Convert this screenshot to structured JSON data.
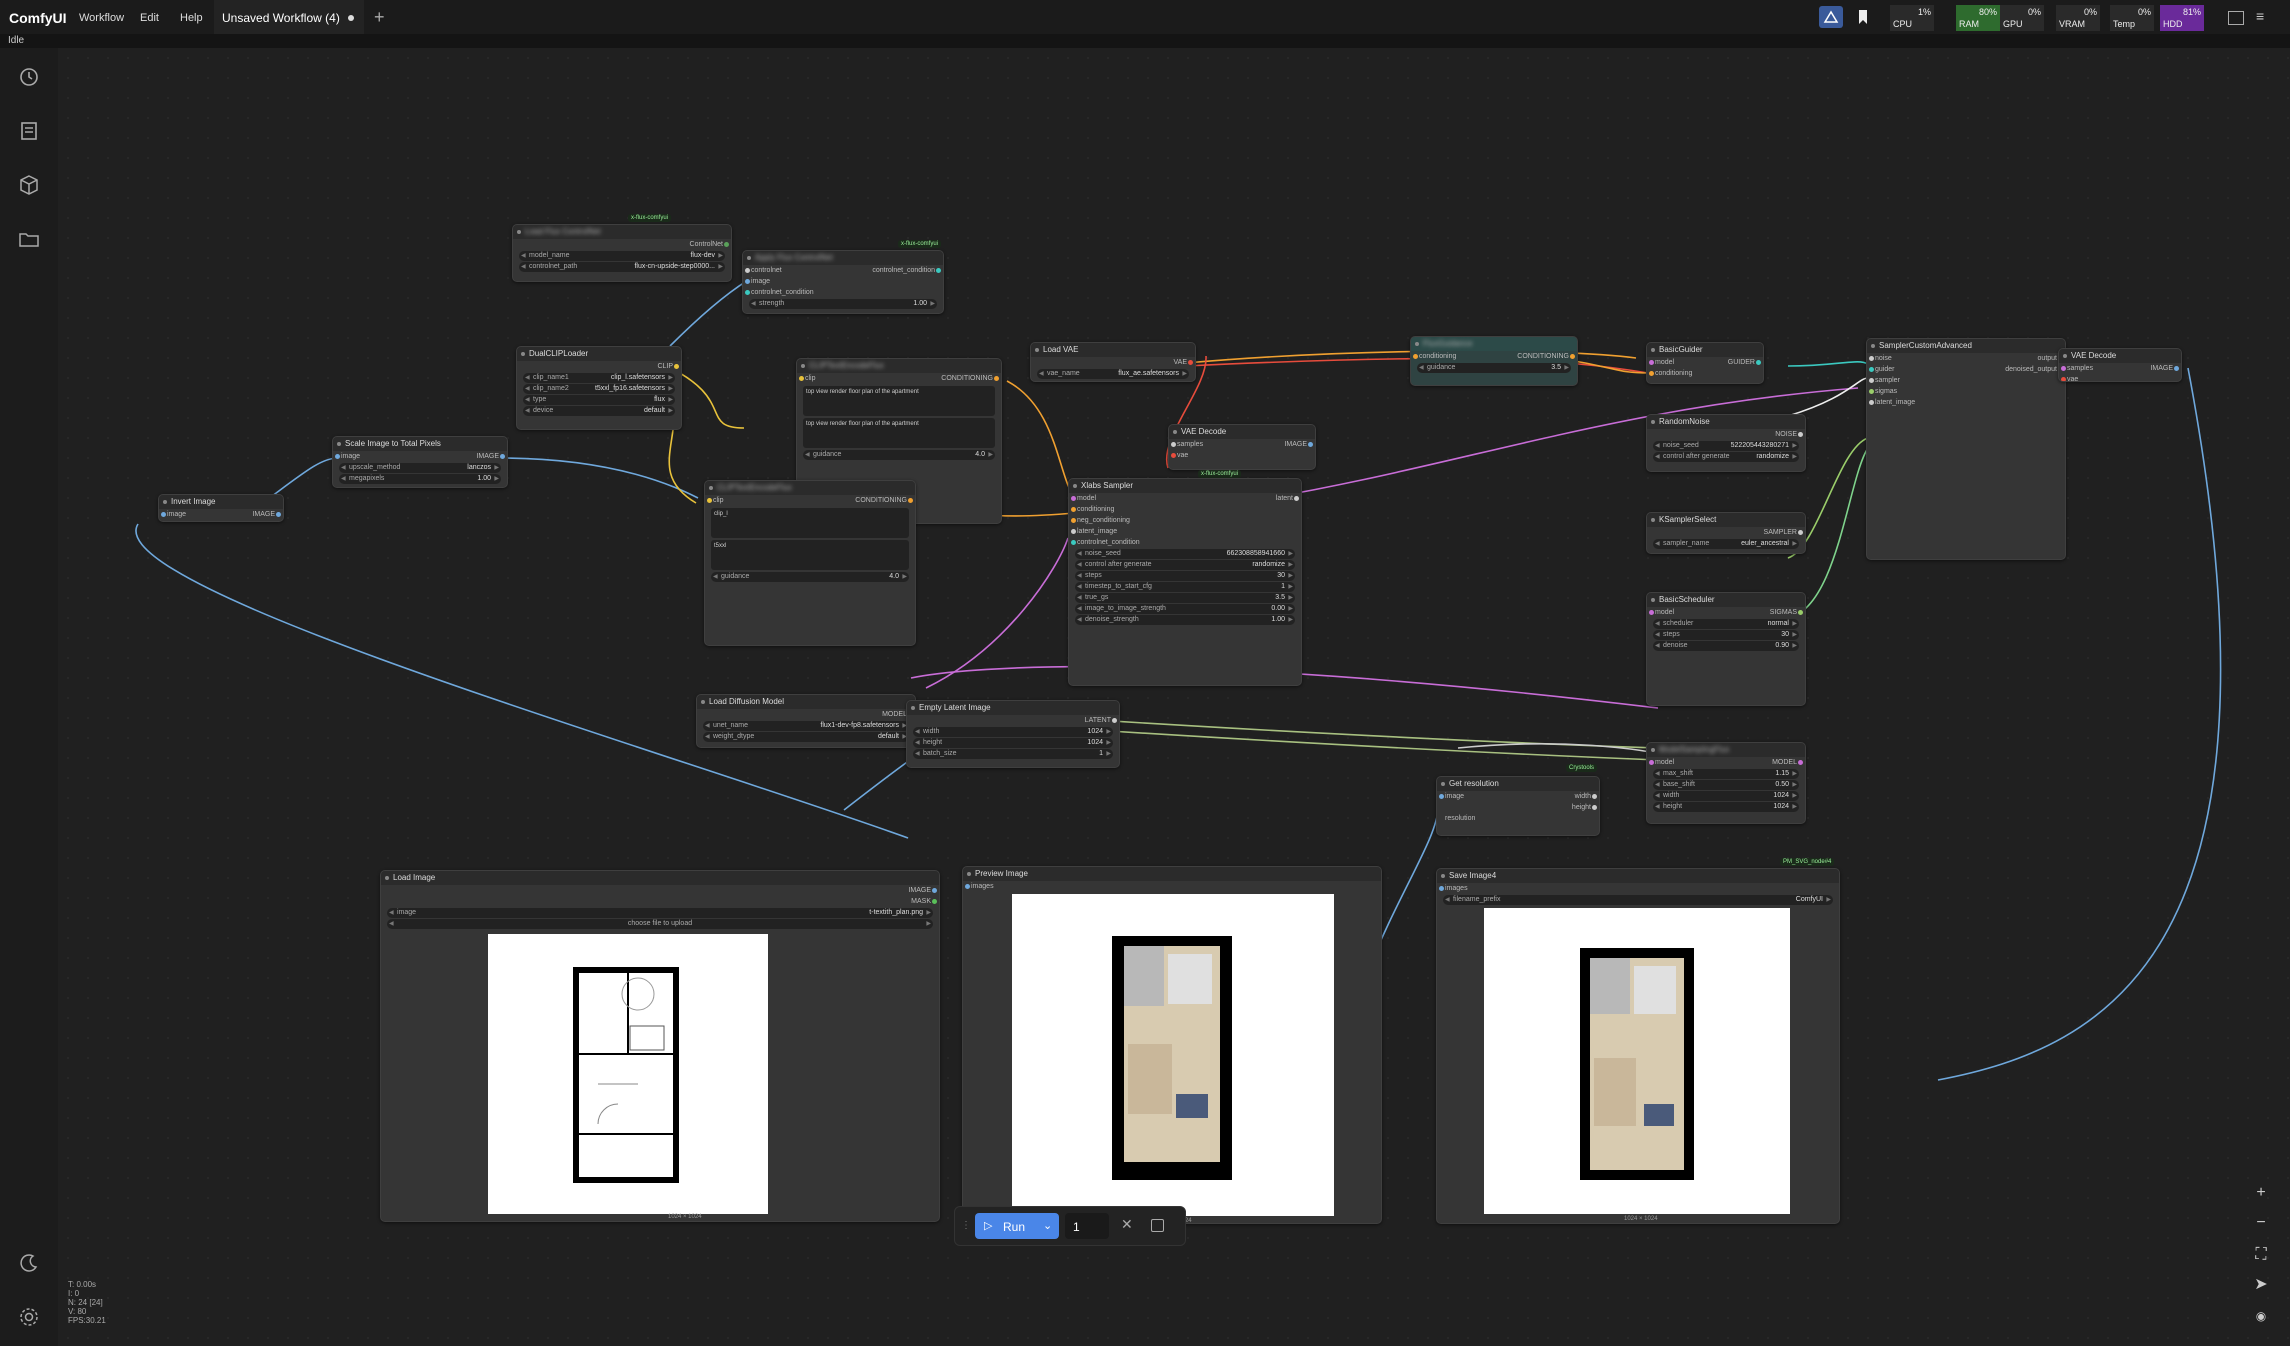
{
  "app": {
    "name": "ComfyUI",
    "status": "Idle"
  },
  "menu": {
    "workflow": "Workflow",
    "edit": "Edit",
    "help": "Help"
  },
  "tab": {
    "title": "Unsaved Workflow (4)"
  },
  "monitor": [
    {
      "name": "CPU",
      "value": "1%",
      "color": "#2a2a2a"
    },
    {
      "name": "RAM",
      "value": "80%",
      "color": "#2e6b2e"
    },
    {
      "name": "GPU",
      "value": "0%",
      "color": "#2a2a2a"
    },
    {
      "name": "VRAM",
      "value": "0%",
      "color": "#2a2a2a"
    },
    {
      "name": "Temp",
      "value": "0%",
      "color": "#2a2a2a"
    },
    {
      "name": "HDD",
      "value": "81%",
      "color": "#6a2a9a"
    }
  ],
  "sidebar": {
    "icons": [
      "history-icon",
      "queue-icon",
      "model-library-icon",
      "workflows-folder-icon"
    ],
    "bottom": [
      "theme-toggle-icon",
      "settings-gear-icon"
    ]
  },
  "nodes": {
    "load_flux_controlnet": {
      "title": "Load Flux ControlNet",
      "badge": "x-flux-comfyui",
      "out": "ControlNet",
      "w1": "model_name",
      "v1": "flux-dev",
      "w2": "controlnet_path",
      "v2": "flux-cn-upside-step0000..."
    },
    "apply_flux_controlnet": {
      "title": "Apply Flux ControlNet",
      "badge": "x-flux-comfyui",
      "in1": "controlnet",
      "in2": "image",
      "in3": "controlnet_condition",
      "out": "controlnet_condition",
      "w1": "strength",
      "v1": "1.00"
    },
    "dual_clip": {
      "title": "DualCLIPLoader",
      "out": "CLIP",
      "w1": "clip_name1",
      "v1": "clip_l.safetensors",
      "w2": "clip_name2",
      "v2": "t5xxl_fp16.safetensors",
      "w3": "type",
      "v3": "flux",
      "w4": "device",
      "v4": "default"
    },
    "clip_encode_1": {
      "title": "CLIPTextEncodeFlux",
      "in": "clip",
      "out": "CONDITIONING",
      "t1": "top view render floor plan of the apartment",
      "t2": "top view render floor plan of the apartment",
      "w1": "guidance",
      "v1": "4.0"
    },
    "scale_image": {
      "title": "Scale Image to Total Pixels",
      "in": "image",
      "out": "IMAGE",
      "w1": "upscale_method",
      "v1": "lanczos",
      "w2": "megapixels",
      "v2": "1.00"
    },
    "invert_image": {
      "title": "Invert Image",
      "in": "image",
      "out": "IMAGE"
    },
    "clip_encode_2": {
      "title": "CLIPTextEncodeFlux",
      "in": "clip",
      "out": "CONDITIONING",
      "t1": "clip_l",
      "t2": "t5xxl",
      "w1": "guidance",
      "v1": "4.0"
    },
    "load_vae": {
      "title": "Load VAE",
      "out": "VAE",
      "w1": "vae_name",
      "v1": "flux_ae.safetensors"
    },
    "vae_decode_1": {
      "title": "VAE Decode",
      "badge": "x-flux-comfyui",
      "in1": "samples",
      "in2": "vae",
      "out": "IMAGE"
    },
    "xlabs_sampler": {
      "title": "Xlabs Sampler",
      "in1": "model",
      "in2": "conditioning",
      "in3": "neg_conditioning",
      "in4": "latent_image",
      "in5": "controlnet_condition",
      "out": "latent",
      "w1": "noise_seed",
      "v1": "662308858941660",
      "w2": "control after generate",
      "v2": "randomize",
      "w3": "steps",
      "v3": "30",
      "w4": "timestep_to_start_cfg",
      "v4": "1",
      "w5": "true_gs",
      "v5": "3.5",
      "w6": "image_to_image_strength",
      "v6": "0.00",
      "w7": "denoise_strength",
      "v7": "1.00"
    },
    "flux_guidance": {
      "title": "FluxGuidance",
      "in": "conditioning",
      "out": "CONDITIONING",
      "w1": "guidance",
      "v1": "3.5"
    },
    "basic_guider": {
      "title": "BasicGuider",
      "in1": "model",
      "in2": "conditioning",
      "out": "GUIDER"
    },
    "random_noise": {
      "title": "RandomNoise",
      "out": "NOISE",
      "w1": "noise_seed",
      "v1": "522205443280271",
      "w2": "control after generate",
      "v2": "randomize"
    },
    "sampler_custom": {
      "title": "SamplerCustomAdvanced",
      "in1": "noise",
      "in2": "guider",
      "in3": "sampler",
      "in4": "sigmas",
      "in5": "latent_image",
      "out1": "output",
      "out2": "denoised_output"
    },
    "vae_decode_2": {
      "title": "VAE Decode",
      "in1": "samples",
      "in2": "vae",
      "out": "IMAGE"
    },
    "ksampler_select": {
      "title": "KSamplerSelect",
      "out": "SAMPLER",
      "w1": "sampler_name",
      "v1": "euler_ancestral"
    },
    "basic_scheduler": {
      "title": "BasicScheduler",
      "in": "model",
      "out": "SIGMAS",
      "w1": "scheduler",
      "v1": "normal",
      "w2": "steps",
      "v2": "30",
      "w3": "denoise",
      "v3": "0.90"
    },
    "load_diffusion": {
      "title": "Load Diffusion Model",
      "out": "MODEL",
      "w1": "unet_name",
      "v1": "flux1-dev-fp8.safetensors",
      "w2": "weight_dtype",
      "v2": "default"
    },
    "empty_latent": {
      "title": "Empty Latent Image",
      "out": "LATENT",
      "w1": "width",
      "v1": "1024",
      "w2": "height",
      "v2": "1024",
      "w3": "batch_size",
      "v3": "1"
    },
    "get_resolution": {
      "title": "Get resolution",
      "badge": "Crystools",
      "in": "image",
      "out1": "width",
      "out2": "height",
      "row": "resolution"
    },
    "model_sampling": {
      "title": "ModelSamplingFlux",
      "in": "model",
      "out": "MODEL",
      "w1": "max_shift",
      "v1": "1.15",
      "w2": "base_shift",
      "v2": "0.50",
      "w3": "width",
      "v3": "1024",
      "w4": "height",
      "v4": "1024"
    },
    "load_image": {
      "title": "Load Image",
      "out1": "IMAGE",
      "out2": "MASK",
      "w1": "image",
      "v1": "t-textith_plan.png",
      "upload": "choose file to upload",
      "size": "1024 × 1024"
    },
    "preview_image": {
      "title": "Preview Image",
      "in": "images",
      "size": "1024 × 1024"
    },
    "save_image": {
      "title": "Save Image4",
      "badge": "PM_SVG_node#4",
      "in": "images",
      "w1": "filename_prefix",
      "v1": "ComfyUI",
      "size": "1024 × 1024"
    }
  },
  "runbar": {
    "run": "Run",
    "count": "1"
  },
  "stats": {
    "t": "T: 0.00s",
    "i": "I: 0",
    "n": "N: 24 [24]",
    "v": "V: 80",
    "fps": "FPS:30.21"
  }
}
